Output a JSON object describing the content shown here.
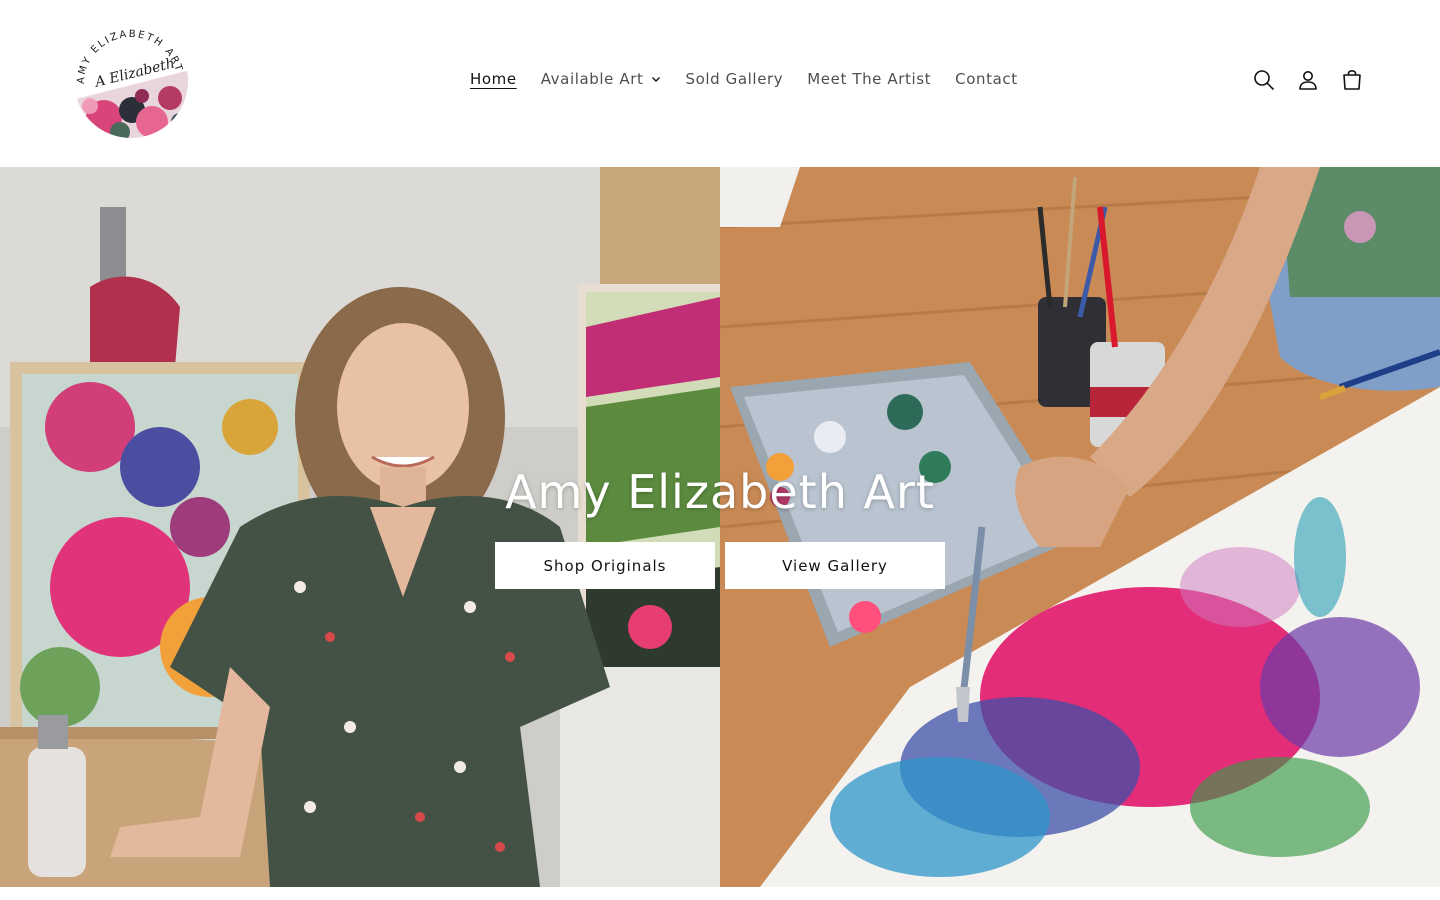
{
  "header": {
    "logo": {
      "ring_text": "AMY ELIZABETH ART",
      "signature": "A Elizabeth"
    },
    "nav": [
      {
        "label": "Home",
        "active": true,
        "has_dropdown": false
      },
      {
        "label": "Available Art",
        "active": false,
        "has_dropdown": true
      },
      {
        "label": "Sold Gallery",
        "active": false,
        "has_dropdown": false
      },
      {
        "label": "Meet The Artist",
        "active": false,
        "has_dropdown": false
      },
      {
        "label": "Contact",
        "active": false,
        "has_dropdown": false
      }
    ],
    "icons": [
      "search-icon",
      "account-icon",
      "cart-icon"
    ]
  },
  "hero": {
    "title": "Amy Elizabeth Art",
    "buttons": [
      {
        "label": "Shop Originals"
      },
      {
        "label": "View Gallery"
      }
    ]
  },
  "colors": {
    "text": "#121212",
    "background": "#ffffff",
    "button_bg": "#ffffff",
    "hero_title": "#ffffff"
  }
}
